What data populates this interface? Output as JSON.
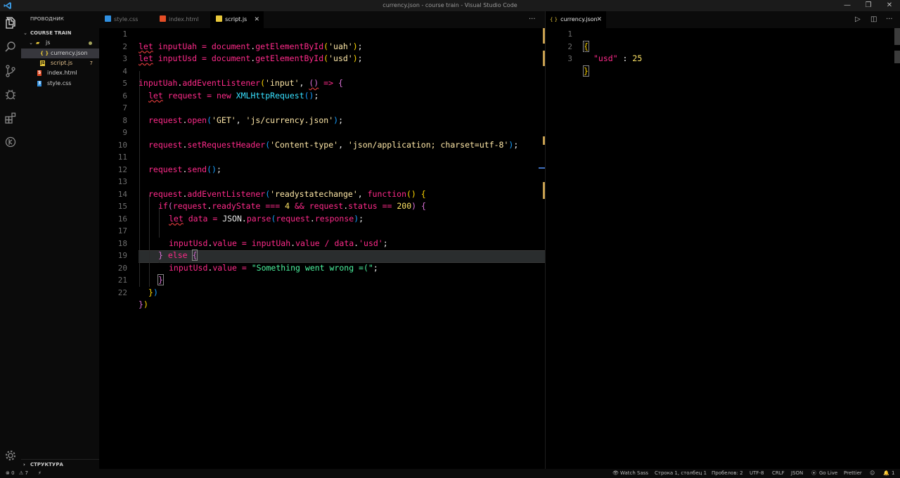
{
  "window": {
    "title": "currency.json - course train - Visual Studio Code",
    "controls": {
      "minimize": "—",
      "restore": "❐",
      "close": "✕"
    }
  },
  "activity_bar": [
    "explorer-icon",
    "search-icon",
    "source-control-icon",
    "debug-icon",
    "extensions-icon",
    "remote-icon",
    "gear-icon"
  ],
  "sidebar": {
    "header": "ПРОВОДНИК",
    "root": "COURSE TRAIN",
    "items": [
      {
        "label": "js",
        "type": "folder"
      },
      {
        "label": "currency.json",
        "icon": "{ }",
        "type": "file"
      },
      {
        "label": "script.js",
        "icon": "JS",
        "badge": "7",
        "type": "file"
      },
      {
        "label": "index.html",
        "icon": "5",
        "type": "file"
      },
      {
        "label": "style.css",
        "icon": "3",
        "type": "file"
      }
    ],
    "outline": "СТРУКТУРА"
  },
  "left_tabs": [
    {
      "label": "style.css",
      "color": "#2f8fe0"
    },
    {
      "label": "index.html",
      "color": "#e44d26"
    },
    {
      "label": "script.js",
      "color": "#e8c83a",
      "close": "✕"
    }
  ],
  "right_tabs": [
    {
      "label": "currency.json",
      "icon": "{ }",
      "close": "✕"
    }
  ],
  "left_editor": {
    "line_numbers": [
      "1",
      "2",
      "3",
      "4",
      "5",
      "6",
      "7",
      "8",
      "9",
      "10",
      "11",
      "12",
      "13",
      "14",
      "15",
      "16",
      "17",
      "18",
      "19",
      "20",
      "21",
      "22"
    ],
    "tokens": {
      "let": "let",
      "inputUah": "inputUah",
      "inputUsd": "inputUsd",
      "eq": " = ",
      "document": "document",
      "dot": ".",
      "getElementById": "getElementById",
      "uah": "'uah'",
      "usd": "'usd'",
      "semi": ";",
      "addEventListener": "addEventListener",
      "input_str": "'input'",
      "arrow": " => ",
      "request": "request",
      "new": "new",
      "XMLHttpRequest": "XMLHttpRequest",
      "open": "open",
      "GET": "'GET'",
      "url": "'js/currency.json'",
      "setRequestHeader": "setRequestHeader",
      "ct": "'Content-type'",
      "ctv": "'json/application; charset=utf-8'",
      "send": "send",
      "rsc": "'readystatechange'",
      "function": "function",
      "if": "if",
      "readyState": "readyState",
      "eqeqeq": " === ",
      "four": "4",
      "and": " && ",
      "status": "status",
      "eqeq": " == ",
      "twohundred": "200",
      "data": "data",
      "JSON": "JSON",
      "parse": "parse",
      "response": "response",
      "value": "value",
      "div": " / ",
      "else": "else",
      "wrong": "\"Something went wrong =(\"",
      "comma": ", "
    }
  },
  "right_editor": {
    "line_numbers": [
      "1",
      "2",
      "3"
    ],
    "open_brace": "{",
    "key": "\"usd\"",
    "colon": " : ",
    "value": "25",
    "close_brace": "}"
  },
  "status_bar": {
    "errors": "⊗ 0",
    "warnings": "⚠ 7",
    "watch_sass": "Watch Sass",
    "position": "Строка 1, столбец 1",
    "spaces": "Пробелов: 2",
    "encoding": "UTF-8",
    "eol": "CRLF",
    "language": "JSON",
    "go_live": "Go Live",
    "prettier": "Prettier",
    "notifications": "1"
  },
  "colors": {
    "accent_keyword": "#ff2a8a",
    "string": "#ffe8a8",
    "green_string": "#4cf5a0",
    "class": "#38e0ff"
  }
}
